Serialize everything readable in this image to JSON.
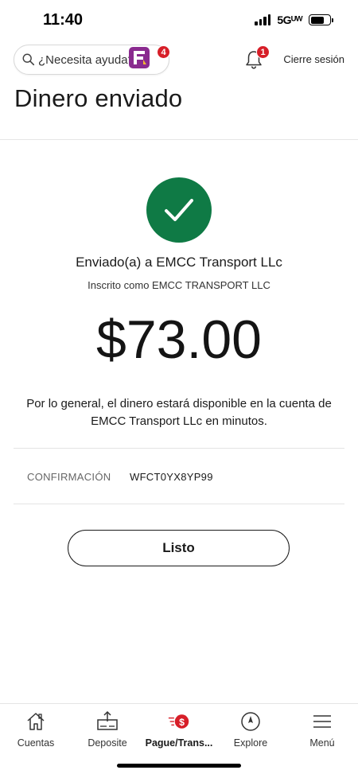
{
  "status_bar": {
    "time": "11:40",
    "network": "5Gᵁᵂ"
  },
  "header": {
    "search_placeholder": "¿Necesita ayuda?",
    "help_badge": "4",
    "notification_badge": "1",
    "logout_label": "Cierre sesión",
    "page_title": "Dinero enviado"
  },
  "confirmation": {
    "sent_to": "Enviado(a) a EMCC Transport LLc",
    "enrolled_as": "Inscrito como EMCC TRANSPORT LLC",
    "amount": "$73.00",
    "availability_message": "Por lo general, el dinero estará disponible en la cuenta de EMCC Transport LLc en minutos.",
    "confirmation_label": "CONFIRMACIÓN",
    "confirmation_number": "WFCT0YX8YP99",
    "done_label": "Listo"
  },
  "bottom_nav": {
    "items": [
      {
        "label": "Cuentas",
        "icon": "home-icon"
      },
      {
        "label": "Deposite",
        "icon": "deposit-check-icon"
      },
      {
        "label": "Pague/Trans...",
        "icon": "pay-transfer-icon",
        "active": true
      },
      {
        "label": "Explore",
        "icon": "compass-icon"
      },
      {
        "label": "Menú",
        "icon": "hamburger-menu-icon"
      }
    ]
  },
  "colors": {
    "success_green": "#0f7a45",
    "badge_red": "#d71e28",
    "brand_purple": "#8a2a8f"
  }
}
